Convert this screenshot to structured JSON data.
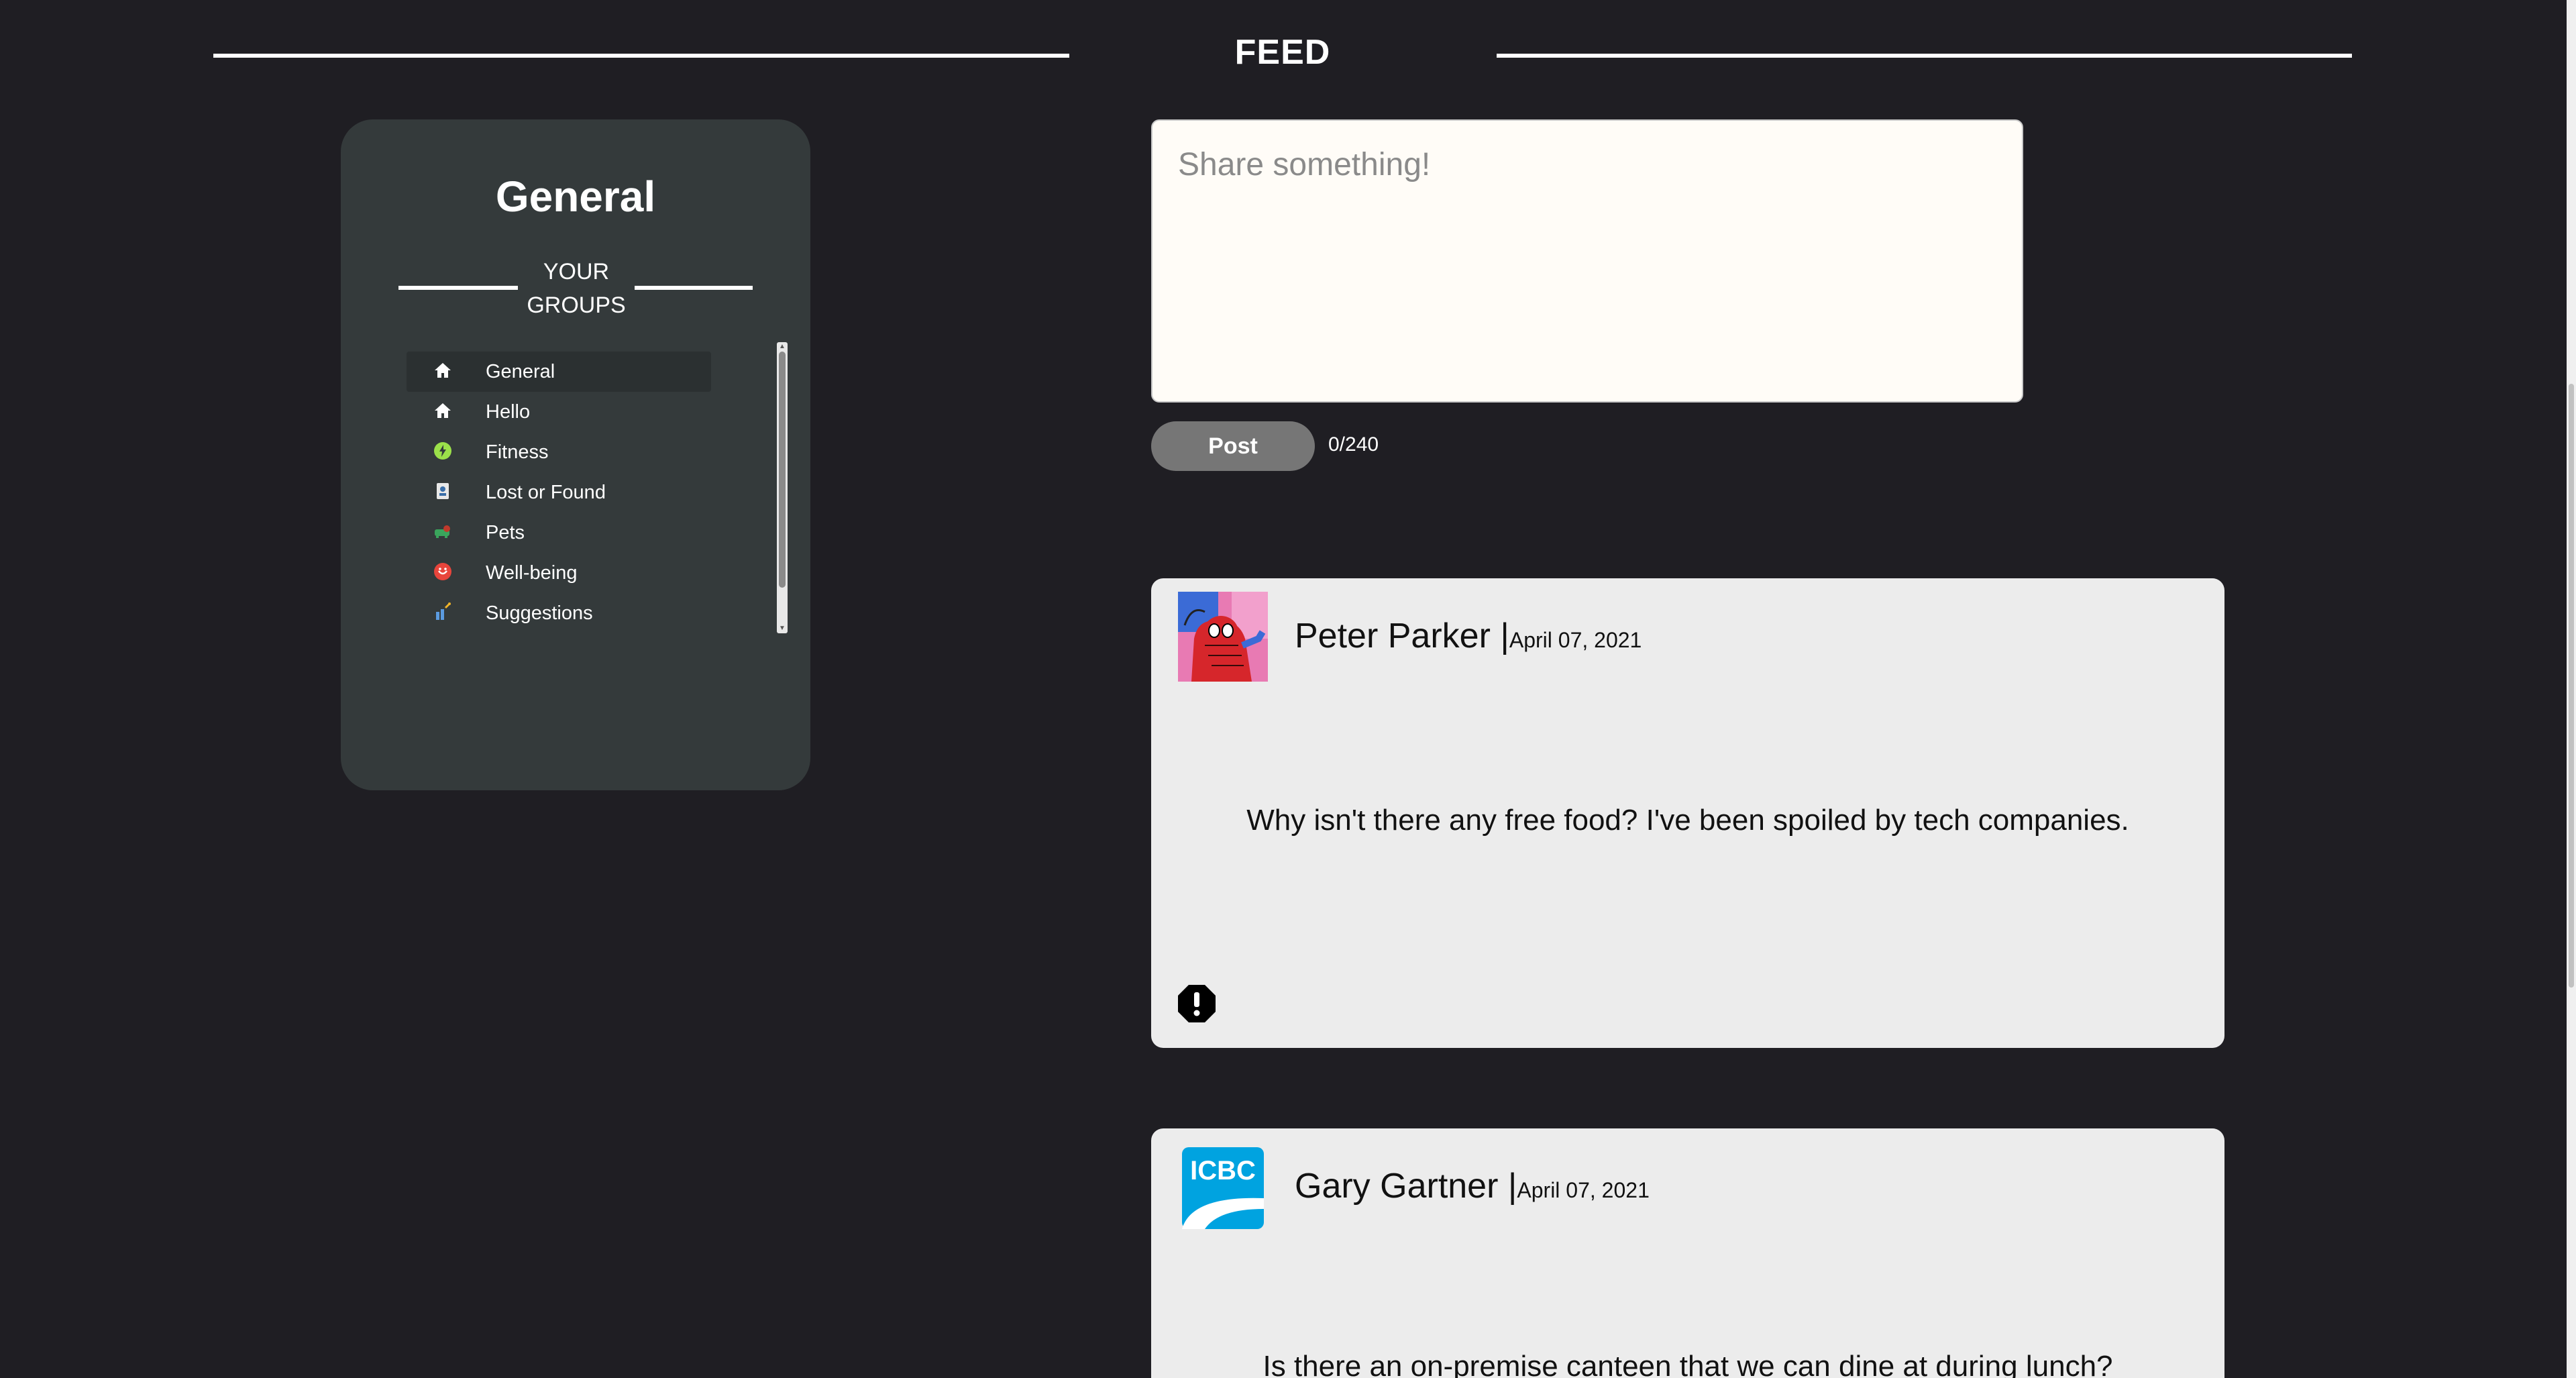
{
  "header": {
    "title": "FEED"
  },
  "sidebar": {
    "current_group": "General",
    "groups_heading_line1": "YOUR",
    "groups_heading_line2": "GROUPS",
    "groups": [
      {
        "label": "General",
        "icon": "home-icon",
        "active": true
      },
      {
        "label": "Hello",
        "icon": "home-icon"
      },
      {
        "label": "Fitness",
        "icon": "fitness-icon",
        "color": "#9be04a"
      },
      {
        "label": "Lost or Found",
        "icon": "lost-found-icon"
      },
      {
        "label": "Pets",
        "icon": "pets-icon",
        "color": "#3aa55c"
      },
      {
        "label": "Well-being",
        "icon": "wellbeing-icon",
        "color": "#e8453c"
      },
      {
        "label": "Suggestions",
        "icon": "suggestions-icon",
        "color": "#5b9be0"
      }
    ]
  },
  "composer": {
    "placeholder": "Share something!",
    "post_label": "Post",
    "char_count": "0/240"
  },
  "posts": [
    {
      "author": "Peter Parker",
      "separator": "|",
      "date": "April 07, 2021",
      "avatar": "spiderman-avatar",
      "body": "Why isn't there any free food? I've been spoiled by tech companies."
    },
    {
      "author": "Gary Gartner",
      "separator": "|",
      "date": "April 07, 2021",
      "avatar": "icbc-logo-avatar",
      "avatar_text": "ICBC",
      "body": "Is there an on-premise canteen that we can dine at during lunch?"
    }
  ],
  "colors": {
    "background": "#1f1e23",
    "sidebar": "#343a3b",
    "post_card": "#ececec",
    "composer": "#fffcf7",
    "post_button": "#767676",
    "icbc_blue": "#00a3e0"
  }
}
